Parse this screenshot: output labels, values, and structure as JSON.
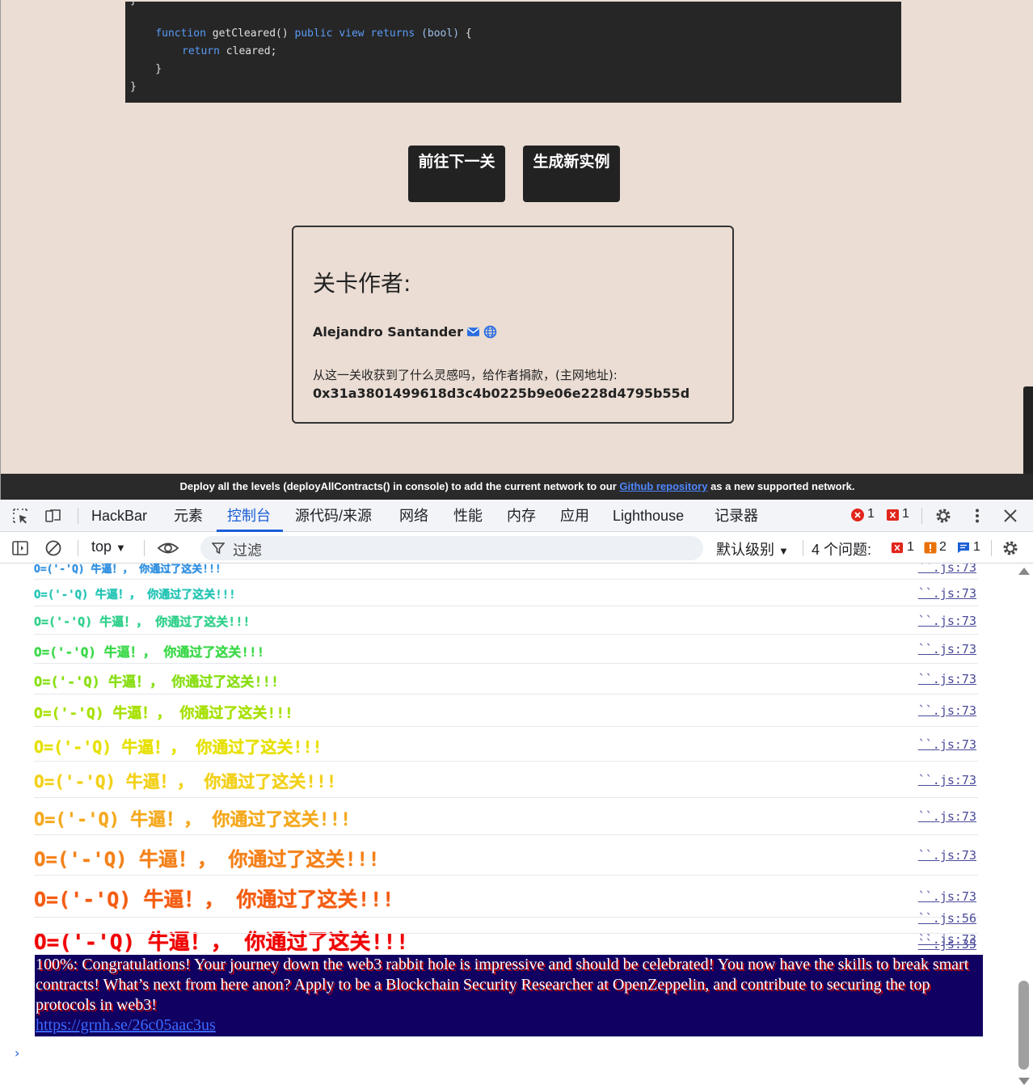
{
  "code": {
    "line1_pre": "    ",
    "kw_function": "function",
    "fn_name": " getCleared() ",
    "kw_public": "public",
    "kw_view": "view",
    "kw_returns": "returns",
    "ret_type": "(bool)",
    "brace_open": " {",
    "kw_return": "return",
    "ret_value": " cleared;",
    "brace_close_inner": "    }",
    "brace_close_outer": "}"
  },
  "buttons": {
    "next_level": "前往下一关",
    "new_instance": "生成新实例"
  },
  "author_card": {
    "heading": "关卡作者:",
    "name": "Alejandro Santander",
    "donate_text": "从这一关收获到了什么灵感吗，给作者捐款，(主网地址):",
    "donate_address": "0x31a3801499618d3c4b0225b9e06e228d4795b55d"
  },
  "banner": {
    "text_before": "Deploy all the levels (deployAllContracts() in console) to add the current network to our ",
    "link": "Github repository",
    "text_after": " as a new supported network."
  },
  "devtools": {
    "tabs": [
      "HackBar",
      "元素",
      "控制台",
      "源代码/来源",
      "网络",
      "性能",
      "内存",
      "应用",
      "Lighthouse",
      "记录器"
    ],
    "active_tab": "控制台",
    "error_count": "1",
    "warning_count": "1"
  },
  "console_toolbar": {
    "context": "top",
    "filter_placeholder": "过滤",
    "level": "默认级别",
    "issues_label": "4 个问题:",
    "issues_error": "1",
    "issues_warning": "2",
    "issues_info": "1"
  },
  "console": {
    "repeat_message": "O=('-'Q) 牛逼！， 你通过了这关!!!",
    "source_main": "``.js:73",
    "rows": [
      {
        "color": "#2f8fe0",
        "size": 13
      },
      {
        "color": "#22c4b4",
        "size": 14
      },
      {
        "color": "#2ed08a",
        "size": 15
      },
      {
        "color": "#38d846",
        "size": 16
      },
      {
        "color": "#86de10",
        "size": 17
      },
      {
        "color": "#a6e000",
        "size": 18
      },
      {
        "color": "#e6e000",
        "size": 20
      },
      {
        "color": "#f2d018",
        "size": 21
      },
      {
        "color": "#f4a81c",
        "size": 22
      },
      {
        "color": "#f48018",
        "size": 24
      },
      {
        "color": "#f45c10",
        "size": 25
      },
      {
        "color": "#f00000",
        "size": 26
      }
    ],
    "source_blank": "``.js:56",
    "source_final": "``.js:35",
    "final_message": "100%: Congratulations! Your journey down the web3 rabbit hole is impressive and should be celebrated! You now have the skills to break smart contracts! What’s next from here anon? Apply to be a Blockchain Security Researcher at OpenZeppelin, and contribute to securing the top protocols in web3!",
    "final_link": "https://grnh.se/26c05aac3us",
    "prompt": "›"
  },
  "icons": {
    "inspect": "inspect-element-icon",
    "device": "device-toolbar-icon",
    "settings": "gear-icon",
    "more": "kebab-menu-icon",
    "close": "close-icon",
    "sidebar": "sidebar-toggle-icon",
    "clear": "clear-console-icon",
    "eye": "live-expression-icon",
    "filter": "filter-icon"
  }
}
